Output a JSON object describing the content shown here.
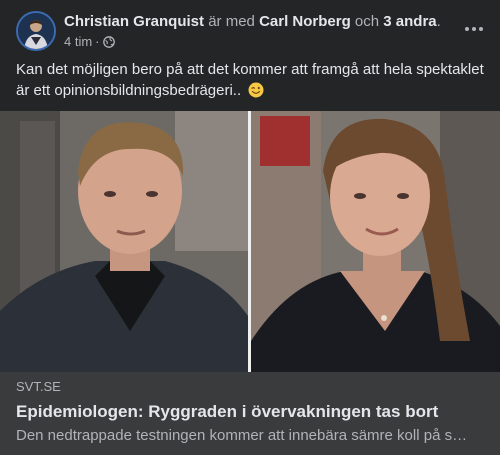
{
  "post": {
    "author": "Christian Granquist",
    "with_text": " är med ",
    "tagged": "Carl Norberg",
    "and_text": " och ",
    "others": "3 andra",
    "period": ".",
    "time": "4 tim",
    "separator": "·",
    "privacy_icon": "globe-icon",
    "more_icon": "more-options-icon",
    "text": "Kan det möjligen bero på att det kommer att framgå att hela spektaklet är ett opinionsbildningsbedrägeri.. ",
    "emoji_icon": "wink-emoji-icon"
  },
  "link_preview": {
    "domain": "SVT.SE",
    "headline": "Epidemiologen: Ryggraden i övervakningen tas bort",
    "description": "Den nedtrappade testningen kommer att innebära sämre koll på s…"
  },
  "colors": {
    "background": "#242526",
    "preview_bg": "#3a3b3c",
    "primary_text": "#e4e6eb",
    "secondary_text": "#b0b3b8"
  }
}
